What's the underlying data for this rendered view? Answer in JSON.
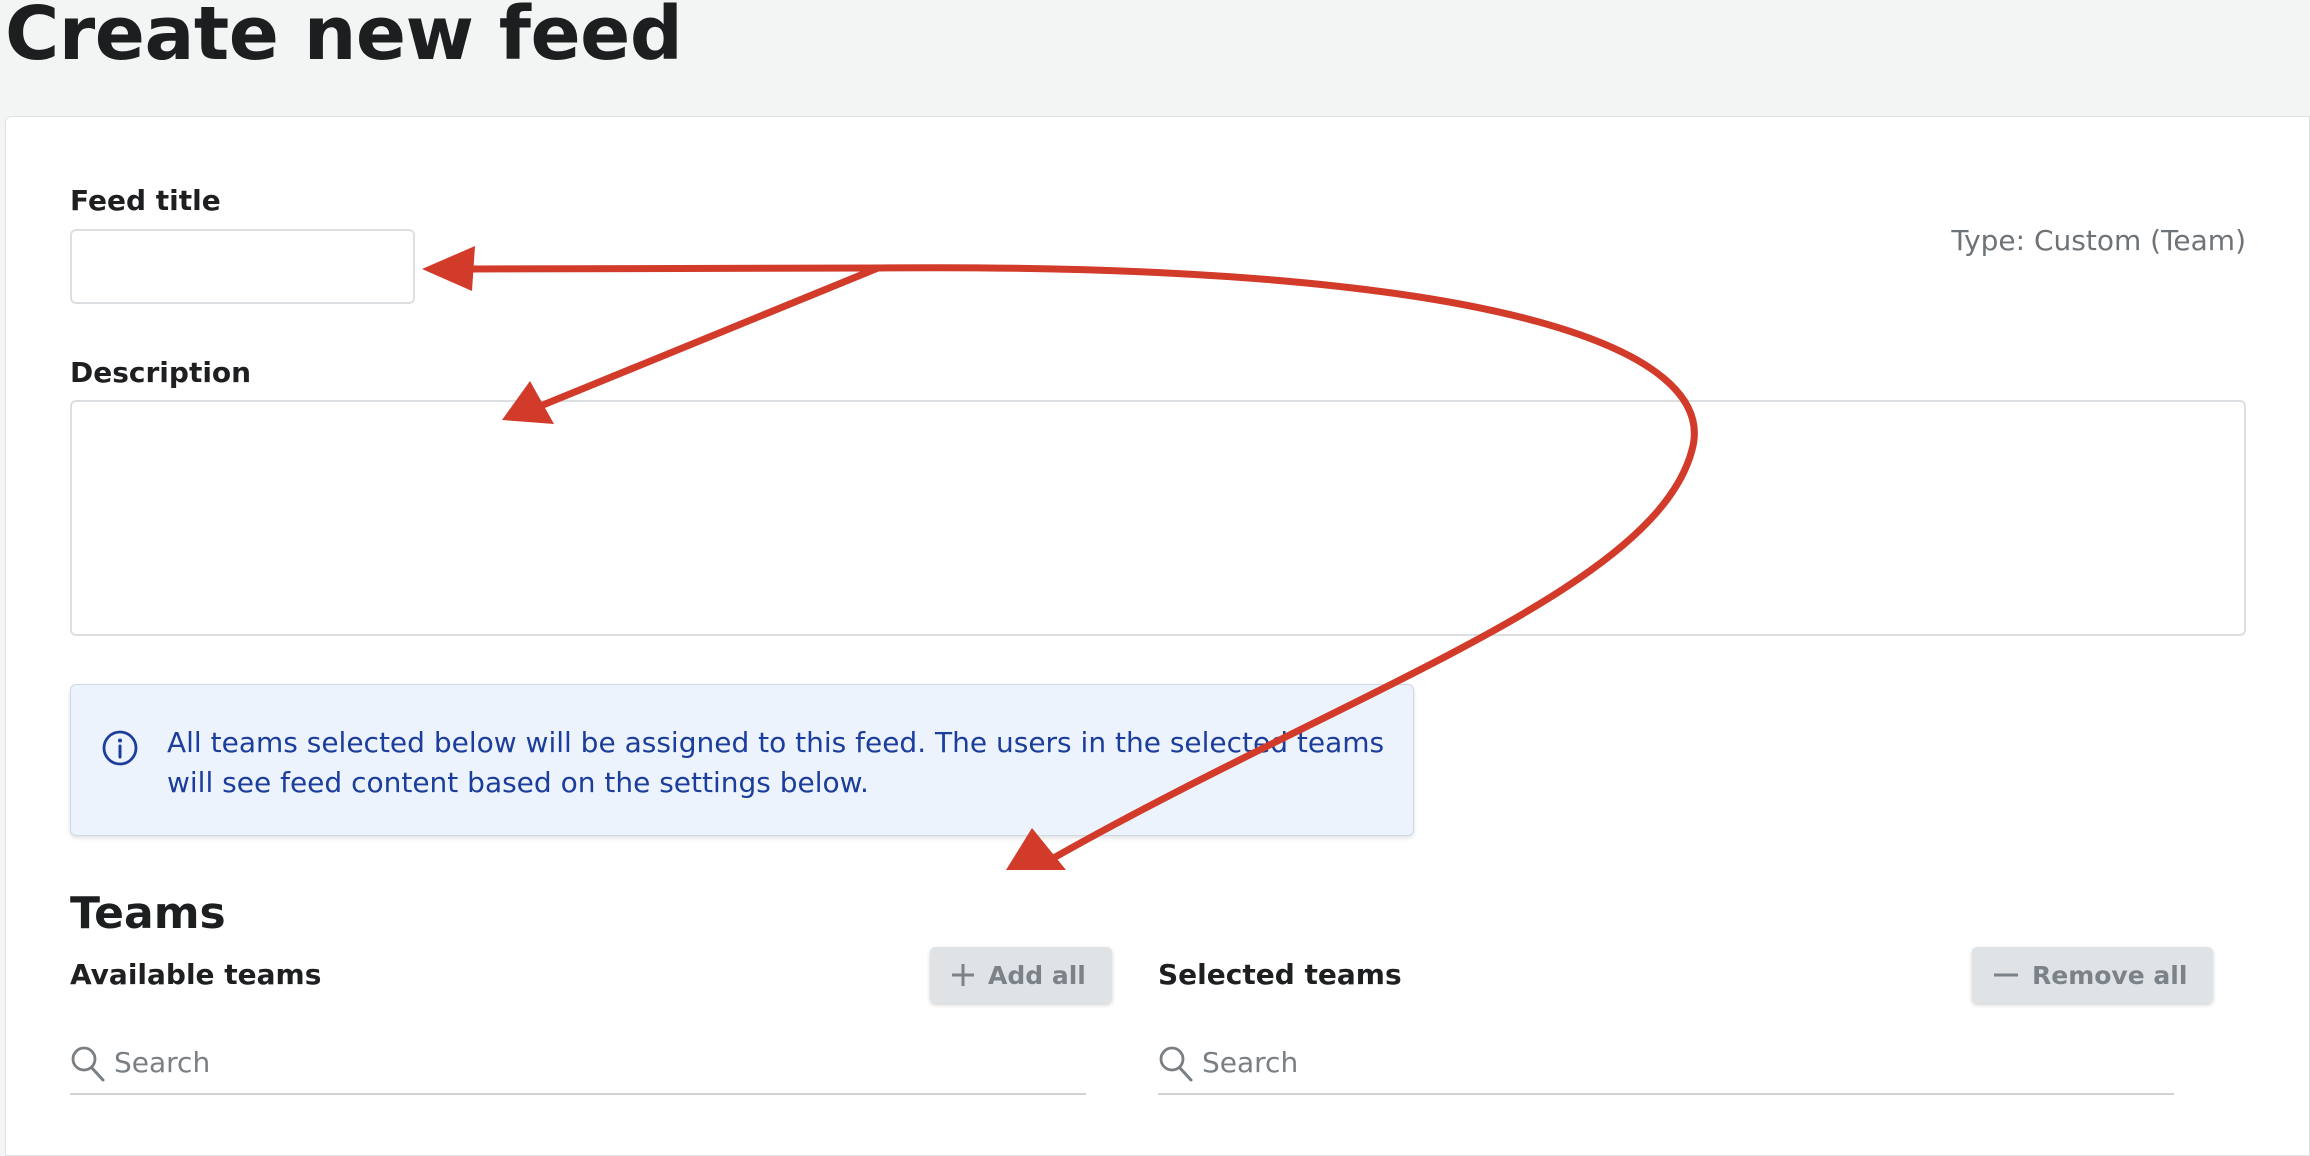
{
  "page": {
    "title": "Create new feed"
  },
  "form": {
    "feed_title_label": "Feed title",
    "feed_title_value": "",
    "type_text": "Type: Custom (Team)",
    "description_label": "Description",
    "description_value": ""
  },
  "info": {
    "text": "All teams selected below will be assigned to this feed. The users in the selected teams will see feed content based on the settings below.",
    "icon": "info-circle-icon"
  },
  "teams": {
    "title": "Teams",
    "available": {
      "label": "Available teams",
      "button_label": "Add all",
      "button_icon": "plus-icon",
      "search_placeholder": "Search"
    },
    "selected": {
      "label": "Selected teams",
      "button_label": "Remove all",
      "button_icon": "minus-icon",
      "search_placeholder": "Search"
    }
  },
  "colors": {
    "annotation_arrows": "#d23b2a",
    "info_text": "#1b3d9c",
    "info_background": "#edf3fc"
  }
}
